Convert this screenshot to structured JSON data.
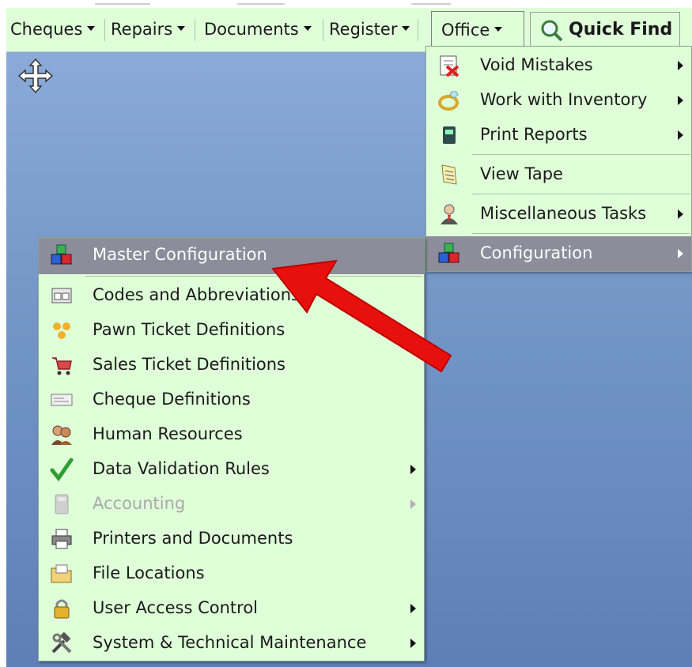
{
  "menubar": {
    "items": [
      {
        "label": "Cheques"
      },
      {
        "label": "Repairs"
      },
      {
        "label": "Documents"
      },
      {
        "label": "Register"
      },
      {
        "label": "Office"
      }
    ],
    "quick_find": "Quick Find"
  },
  "office_menu": {
    "items": [
      {
        "label": "Void Mistakes",
        "submenu": true
      },
      {
        "label": "Work with Inventory",
        "submenu": true
      },
      {
        "label": "Print Reports",
        "submenu": true
      },
      {
        "label": "View Tape",
        "submenu": false
      },
      {
        "label": "Miscellaneous Tasks",
        "submenu": true
      },
      {
        "label": "Configuration",
        "submenu": true,
        "highlighted": true
      }
    ]
  },
  "config_menu": {
    "items": [
      {
        "label": "Master Configuration",
        "highlighted": true
      },
      {
        "label": "Codes and Abbreviations"
      },
      {
        "label": "Pawn Ticket Definitions"
      },
      {
        "label": "Sales Ticket Definitions"
      },
      {
        "label": "Cheque Definitions"
      },
      {
        "label": "Human Resources"
      },
      {
        "label": "Data Validation Rules",
        "submenu": true
      },
      {
        "label": "Accounting",
        "submenu": true,
        "disabled": true
      },
      {
        "label": "Printers and Documents"
      },
      {
        "label": "File Locations"
      },
      {
        "label": "User Access Control",
        "submenu": true
      },
      {
        "label": "System & Technical Maintenance",
        "submenu": true
      }
    ]
  },
  "colors": {
    "menu_bg": "#dfffd9",
    "highlight": "#8c8c9a",
    "desktop": "#7497c8",
    "arrow": "#e8100c"
  }
}
